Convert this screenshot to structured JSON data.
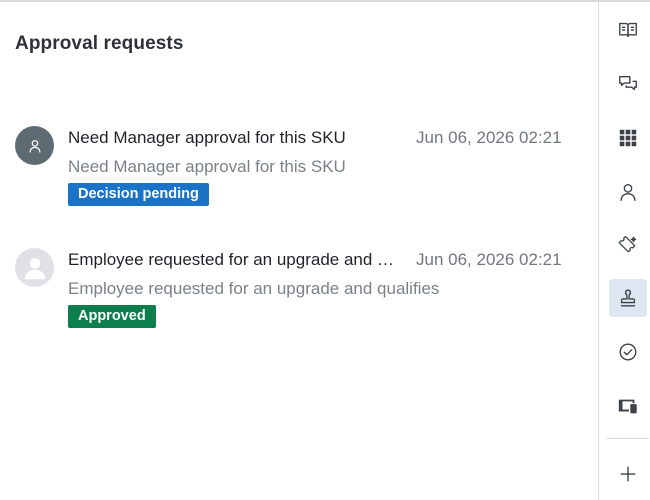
{
  "panel": {
    "title": "Approval requests"
  },
  "requests": [
    {
      "title": "Need Manager approval for this SKU",
      "time": "Jun 06, 2026 02:21",
      "subtitle": "Need Manager approval for this SKU",
      "status": "Decision pending",
      "status_color": "#1a73c6"
    },
    {
      "title": "Employee requested for an upgrade and qualifies",
      "time": "Jun 06, 2026 02:21",
      "subtitle": "Employee requested for an upgrade and qualifies",
      "status": "Approved",
      "status_color": "#0c7f4c"
    }
  ],
  "sidebar": {
    "active_color": "#dde6f1",
    "items": [
      {
        "icon": "book-icon"
      },
      {
        "icon": "chat-bubbles-icon"
      },
      {
        "icon": "apps-grid-icon"
      },
      {
        "icon": "user-icon"
      },
      {
        "icon": "ticket-sparkle-icon"
      },
      {
        "icon": "stamp-icon",
        "active": true
      },
      {
        "icon": "check-circle-icon"
      },
      {
        "icon": "devices-icon"
      },
      {
        "icon": "plus-icon"
      }
    ]
  }
}
